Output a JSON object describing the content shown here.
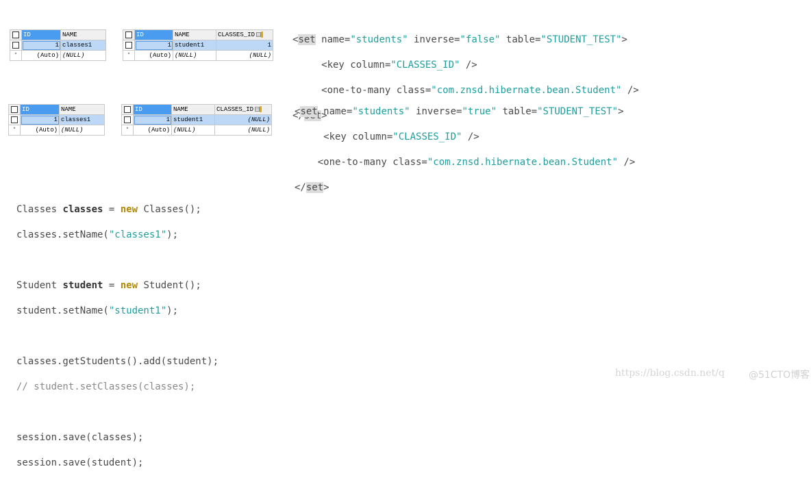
{
  "tables": {
    "classes_before": {
      "headers": [
        "ID",
        "NAME"
      ],
      "rows": [
        [
          "1",
          "classes1"
        ]
      ],
      "new_row": [
        "(Auto)",
        "(NULL)"
      ]
    },
    "student_before": {
      "headers": [
        "ID",
        "NAME",
        "CLASSES_ID"
      ],
      "rows": [
        [
          "1",
          "student1",
          "1"
        ]
      ],
      "new_row": [
        "(Auto)",
        "(NULL)",
        "(NULL)"
      ]
    },
    "classes_after": {
      "headers": [
        "ID",
        "NAME"
      ],
      "rows": [
        [
          "1",
          "classes1"
        ]
      ],
      "new_row": [
        "(Auto)",
        "(NULL)"
      ]
    },
    "student_after": {
      "headers": [
        "ID",
        "NAME",
        "CLASSES_ID"
      ],
      "rows": [
        [
          "1",
          "student1",
          "(NULL)"
        ]
      ],
      "new_row": [
        "(Auto)",
        "(NULL)",
        "(NULL)"
      ]
    },
    "new_row_marker": "*"
  },
  "mapping_false": {
    "open_lt": "<",
    "set_tag": "set",
    "attr1": " name=",
    "val1": "\"students\"",
    "attr2": " inverse=",
    "val2": "\"false\"",
    "attr3": " table=",
    "val3": "\"STUDENT_TEST\"",
    "close_gt": ">",
    "key_open": "     <key column=",
    "key_val": "\"CLASSES_ID\"",
    "key_close": " />",
    "otm_open": "     <one-to-many class=",
    "otm_val": "\"com.znsd.hibernate.bean.Student\"",
    "otm_close": " />",
    "end_open": "</",
    "end_tag": "set",
    "end_close": ">"
  },
  "mapping_true": {
    "open_lt": "<",
    "set_tag": "set",
    "attr1": " name=",
    "val1": "\"students\"",
    "attr2": " inverse=",
    "val2": "\"true\"",
    "attr3": " table=",
    "val3": "\"STUDENT_TEST\"",
    "close_gt": ">",
    "key_open": "     <key column=",
    "key_val": "\"CLASSES_ID\"",
    "key_close": " />",
    "otm_open": "    <one-to-many class=",
    "otm_val": "\"com.znsd.hibernate.bean.Student\"",
    "otm_close": " />",
    "end_open": "</",
    "end_tag": "set",
    "end_close": ">"
  },
  "java_code": {
    "l1_type": "Classes ",
    "l1_var": "classes",
    "l1_eq": " = ",
    "l1_new": "new",
    "l1_rest": " Classes();",
    "l2_pre": "classes.setName(",
    "l2_str": "\"classes1\"",
    "l2_post": ");",
    "l4_type": "Student ",
    "l4_var": "student",
    "l4_eq": " = ",
    "l4_new": "new",
    "l4_rest": " Student();",
    "l5_pre": "student.setName(",
    "l5_str": "\"student1\"",
    "l5_post": ");",
    "l7": "classes.getStudents().add(student);",
    "l8_comment": "// student.setClasses(classes);",
    "l10": "session.save(classes);",
    "l11": "session.save(student);"
  },
  "watermark": {
    "url": "https://blog.csdn.net/q",
    "overlay": "@51CTO博客"
  }
}
